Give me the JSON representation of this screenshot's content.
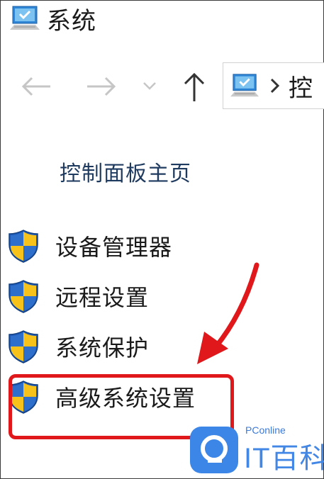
{
  "window": {
    "title": "系统"
  },
  "nav": {
    "address_text": "控"
  },
  "side_panel": {
    "home_link": "控制面板主页",
    "links": [
      {
        "label": "设备管理器",
        "icon": "uac-shield-icon"
      },
      {
        "label": "远程设置",
        "icon": "uac-shield-icon"
      },
      {
        "label": "系统保护",
        "icon": "uac-shield-icon"
      },
      {
        "label": "高级系统设置",
        "icon": "uac-shield-icon"
      }
    ]
  },
  "annotation": {
    "highlighted_item": "高级系统设置",
    "color": "#e0181b"
  },
  "watermark": {
    "brand": "PConline",
    "text": "IT百科"
  },
  "colors": {
    "shield_blue": "#1e5bb8",
    "shield_yellow": "#f7c21a",
    "link_blue": "#1f3a5f"
  }
}
